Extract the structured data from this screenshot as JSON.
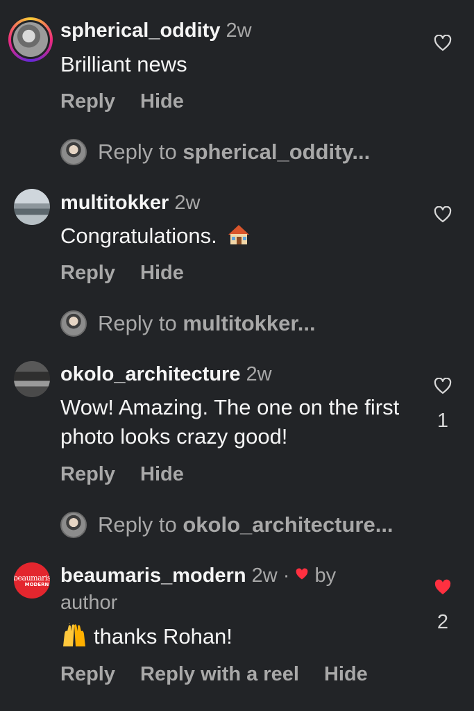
{
  "comments": [
    {
      "username": "spherical_oddity",
      "time": "2w",
      "text": "Brilliant news",
      "actions": [
        "Reply",
        "Hide"
      ],
      "liked": false,
      "reply_prompt_prefix": "Reply to ",
      "reply_prompt_user": "spherical_oddity..."
    },
    {
      "username": "multitokker",
      "time": "2w",
      "text": "Congratulations.",
      "emoji": "house-emoji",
      "actions": [
        "Reply",
        "Hide"
      ],
      "liked": false,
      "reply_prompt_prefix": "Reply to ",
      "reply_prompt_user": "multitokker..."
    },
    {
      "username": "okolo_architecture",
      "time": "2w",
      "text": "Wow! Amazing. The one on the first photo looks crazy good!",
      "actions": [
        "Reply",
        "Hide"
      ],
      "liked": false,
      "like_count": "1",
      "reply_prompt_prefix": "Reply to ",
      "reply_prompt_user": "okolo_architecture..."
    },
    {
      "username": "beaumaris_modern",
      "time": "2w",
      "separator": "·",
      "byline": "by",
      "byline_2": "author",
      "text": "thanks Rohan!",
      "emoji": "raised-hands-emoji",
      "avatar_text_top": "beaumaris",
      "avatar_text_bottom": "MODERN",
      "actions": [
        "Reply",
        "Reply with a reel",
        "Hide"
      ],
      "liked": true,
      "like_count": "2"
    }
  ],
  "colors": {
    "background": "#222427",
    "secondary_text": "#a8a8a8",
    "like_red": "#ff3040",
    "brand_red": "#e3262e"
  }
}
